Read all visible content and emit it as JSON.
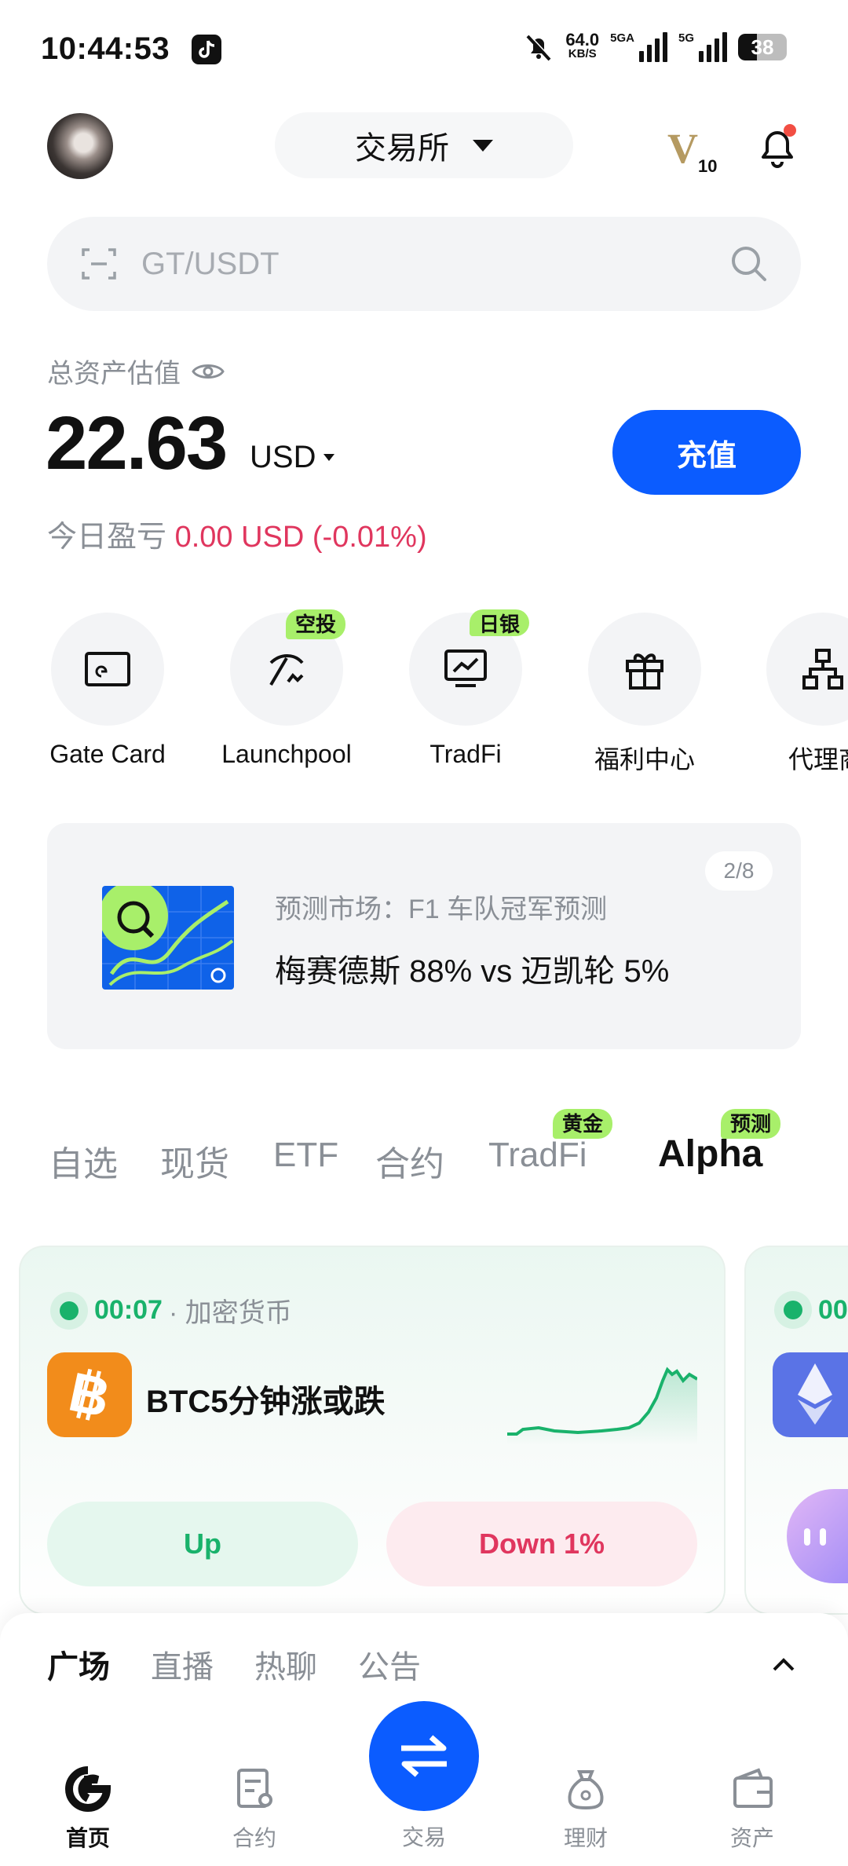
{
  "status_bar": {
    "time": "10:44:53",
    "net_speed": "64.0",
    "net_unit": "KB/S",
    "net1": "5GA",
    "net2": "5G",
    "battery": "38",
    "battery_level": 0.38
  },
  "header": {
    "exchange_label": "交易所",
    "vip_letter": "V",
    "vip_level": "10"
  },
  "search": {
    "placeholder": "GT/USDT"
  },
  "assets": {
    "label": "总资产估值",
    "balance": "22.63",
    "currency": "USD",
    "deposit_label": "充值",
    "pnl_label": "今日盈亏",
    "pnl_value": "0.00 USD (-0.01%)"
  },
  "shortcuts": [
    {
      "label": "Gate Card",
      "tag": ""
    },
    {
      "label": "Launchpool",
      "tag": "空投"
    },
    {
      "label": "TradFi",
      "tag": "日银"
    },
    {
      "label": "福利中心",
      "tag": ""
    },
    {
      "label": "代理商",
      "tag": ""
    }
  ],
  "banner": {
    "subtitle": "预测市场：F1 车队冠军预测",
    "title": "梅赛德斯 88% vs 迈凯轮 5%",
    "pager": "2/8"
  },
  "market_tabs": [
    {
      "label": "自选",
      "tag": ""
    },
    {
      "label": "现货",
      "tag": ""
    },
    {
      "label": "ETF",
      "tag": ""
    },
    {
      "label": "合约",
      "tag": ""
    },
    {
      "label": "TradFi",
      "tag": "黄金"
    },
    {
      "label": "Alpha",
      "tag": "预测"
    }
  ],
  "market_card": {
    "timer": "00:07",
    "category": "· 加密货币",
    "title": "BTC5分钟涨或跌",
    "up_label": "Up",
    "down_label": "Down 1%",
    "second_timer": "00"
  },
  "sheet": {
    "tabs": [
      "广场",
      "直播",
      "热聊",
      "公告"
    ]
  },
  "bottom_nav": {
    "home": "首页",
    "futures": "合约",
    "trade": "交易",
    "earn": "理财",
    "assets": "资产"
  },
  "colors": {
    "accent": "#0b5cff",
    "up": "#19b26b",
    "down": "#e0365e",
    "tag": "#a8ef6a",
    "btc": "#f28c1b"
  }
}
